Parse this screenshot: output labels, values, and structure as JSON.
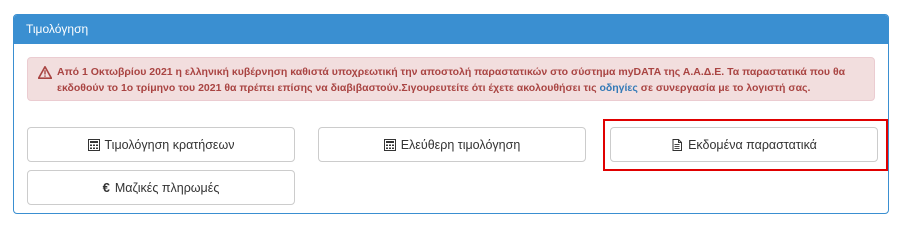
{
  "panel": {
    "title": "Τιμολόγηση"
  },
  "alert": {
    "text_before_link": "Από 1 Οκτωβρίου 2021 η ελληνική κυβέρνηση καθιστά υποχρεωτική την αποστολή παραστατικών στο σύστημα myDATA της Α.Α.Δ.Ε. Τα παραστατικά που θα εκδοθούν το 1ο τρίμηνο του 2021 θα πρέπει επίσης να διαβιβαστούν.Σιγουρευτείτε ότι έχετε ακολουθήσει τις ",
    "link_text": "οδηγίες",
    "text_after_link": " σε συνεργασία με το λογιστή σας.",
    "icon": "warning-triangle-icon",
    "text_color": "#a94442",
    "background_color": "#f2dede"
  },
  "buttons": {
    "reservations_invoicing": {
      "label": "Τιμολόγηση κρατήσεων",
      "icon": "calculator-icon"
    },
    "free_invoicing": {
      "label": "Ελεύθερη τιμολόγηση",
      "icon": "calculator-icon"
    },
    "issued_documents": {
      "label": "Εκδομένα παραστατικά",
      "icon": "document-icon"
    },
    "bulk_payments": {
      "label": "Μαζικές πληρωμές",
      "icon": "euro-icon",
      "symbol": "€"
    }
  },
  "colors": {
    "panel_accent": "#3a8fd1",
    "highlight": "#e00000",
    "link": "#337ab7"
  }
}
